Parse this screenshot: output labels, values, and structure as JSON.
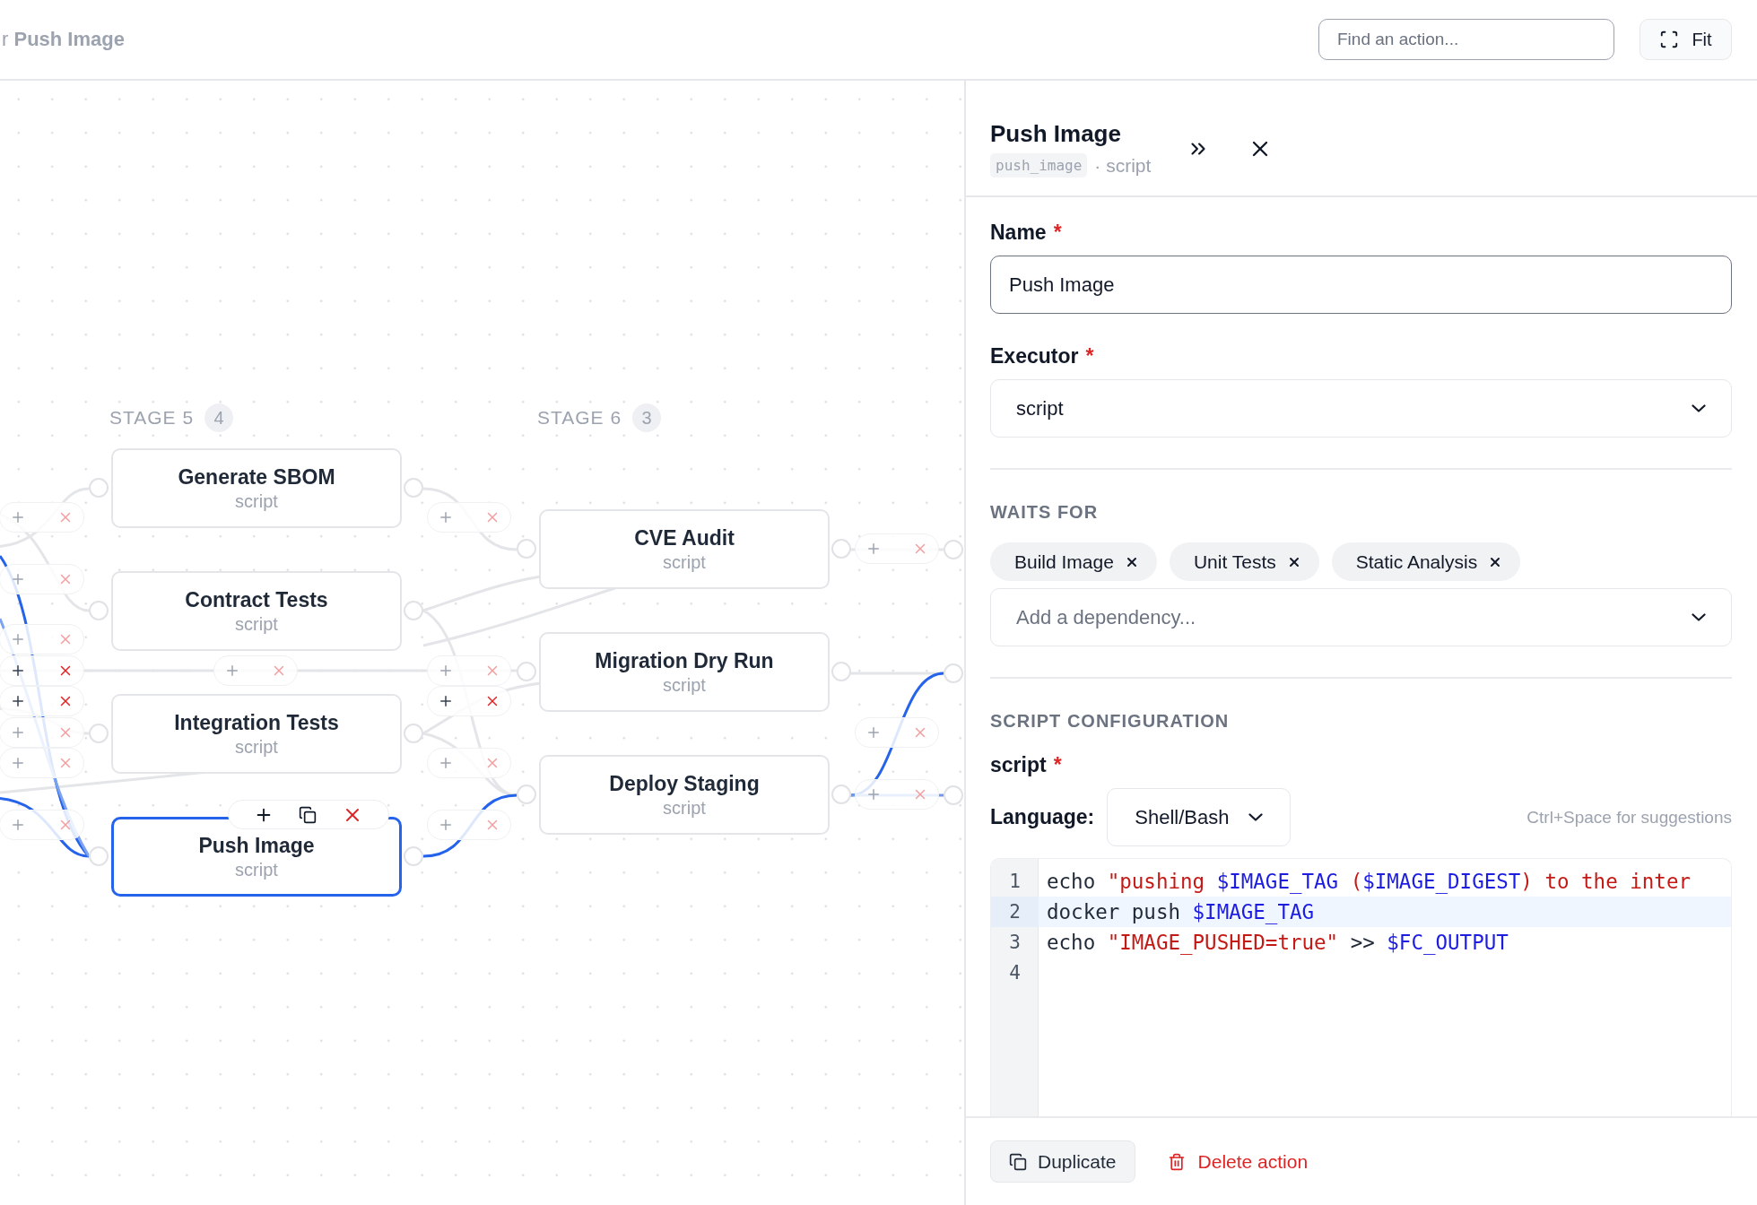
{
  "header": {
    "breadcrumb": "r **Push Image**",
    "search": {
      "placeholder": "Find an action..."
    },
    "fit_button": "Fit"
  },
  "canvas": {
    "stages": [
      {
        "label": "STAGE 5",
        "count": "4",
        "actions": [
          {
            "name": "Generate SBOM",
            "executor": "script",
            "selected": false
          },
          {
            "name": "Contract Tests",
            "executor": "script",
            "selected": false
          },
          {
            "name": "Integration Tests",
            "executor": "script",
            "selected": false
          },
          {
            "name": "Push Image",
            "executor": "script",
            "selected": true
          }
        ]
      },
      {
        "label": "STAGE 6",
        "count": "3",
        "actions": [
          {
            "name": "CVE Audit",
            "executor": "script",
            "selected": false
          },
          {
            "name": "Migration Dry Run",
            "executor": "script",
            "selected": false
          },
          {
            "name": "Deploy Staging",
            "executor": "script",
            "selected": false
          }
        ]
      }
    ],
    "edge_controls": [
      {
        "emphasized": false
      },
      {
        "emphasized": false
      },
      {
        "emphasized": false
      },
      {
        "emphasized": true
      },
      {
        "emphasized": true
      },
      {
        "emphasized": false
      },
      {
        "emphasized": false
      },
      {
        "emphasized": false
      },
      {
        "emphasized": false
      },
      {
        "emphasized": false
      },
      {
        "emphasized": true
      },
      {
        "emphasized": false
      },
      {
        "emphasized": false
      },
      {
        "emphasized": false
      },
      {
        "emphasized": false
      },
      {
        "emphasized": false
      },
      {
        "emphasized": false
      }
    ]
  },
  "panel": {
    "title": "Push Image",
    "id": "push_image",
    "executor_note": "· script",
    "fields": [
      {
        "kind": "text",
        "label": "Name",
        "required_marker": "*",
        "value": "Push Image"
      },
      {
        "kind": "select",
        "label": "Executor",
        "required_marker": "*",
        "value": "script"
      }
    ],
    "waits_for": {
      "heading": "WAITS FOR",
      "chips": [
        "Build Image",
        "Unit Tests",
        "Static Analysis"
      ],
      "placeholder": "Add a dependency..."
    },
    "script_config": {
      "heading": "SCRIPT CONFIGURATION",
      "field_label": "script",
      "required_marker": "*",
      "language_label": "Language:",
      "language": "Shell/Bash",
      "hint": "Ctrl+Space for suggestions",
      "lines": [
        {
          "number": "1",
          "highlighted": false,
          "tokens": [
            {
              "kind": "plain",
              "text": "echo "
            },
            {
              "kind": "string",
              "text": "\"pushing "
            },
            {
              "kind": "variable",
              "text": "$IMAGE_TAG"
            },
            {
              "kind": "string",
              "text": " ("
            },
            {
              "kind": "variable",
              "text": "$IMAGE_DIGEST"
            },
            {
              "kind": "string",
              "text": ") to the inter"
            }
          ]
        },
        {
          "number": "2",
          "highlighted": true,
          "tokens": [
            {
              "kind": "plain",
              "text": "docker push "
            },
            {
              "kind": "variable",
              "text": "$IMAGE_TAG"
            }
          ]
        },
        {
          "number": "3",
          "highlighted": false,
          "tokens": [
            {
              "kind": "plain",
              "text": "echo "
            },
            {
              "kind": "string",
              "text": "\"IMAGE_PUSHED=true\""
            },
            {
              "kind": "plain",
              "text": " >> "
            },
            {
              "kind": "variable",
              "text": "$FC_OUTPUT"
            }
          ]
        },
        {
          "number": "4",
          "highlighted": false
        }
      ]
    },
    "footer": {
      "duplicate": "Duplicate",
      "delete": "Delete action"
    }
  }
}
